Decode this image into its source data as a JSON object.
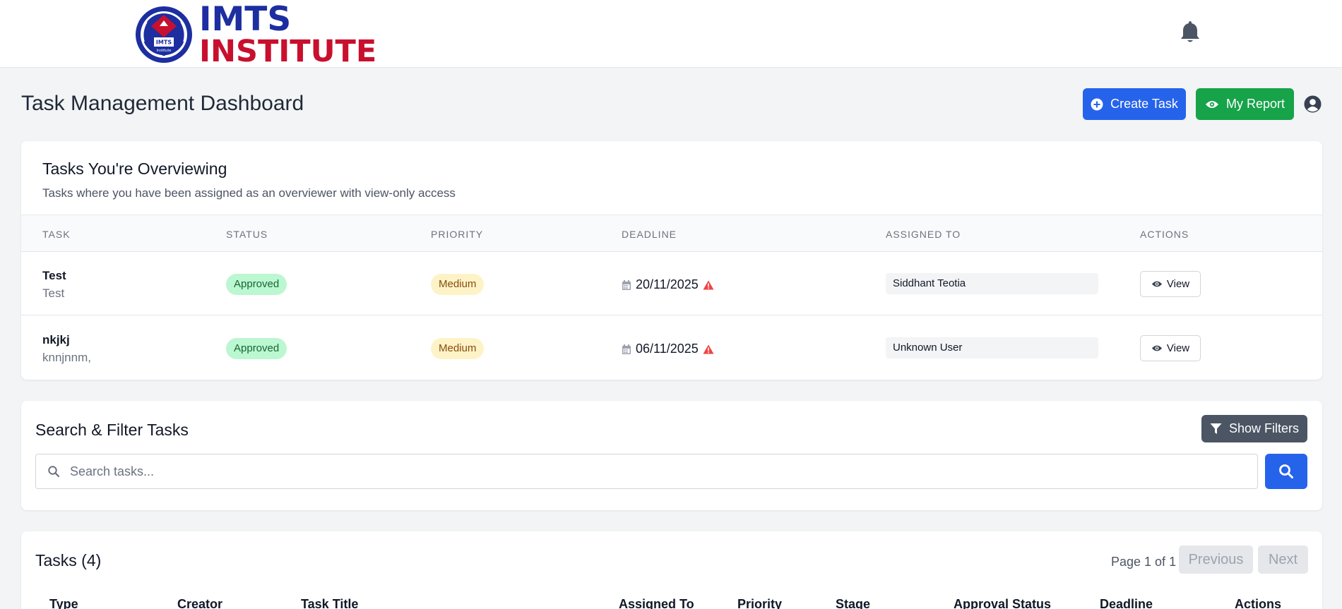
{
  "header": {
    "logo": {
      "line1": "IMTS",
      "line2": "INSTITUTE",
      "seal_text": "IMTS",
      "seal_subtext": "Institute"
    },
    "bell_icon": "bell-icon"
  },
  "page": {
    "title": "Task Management Dashboard",
    "create_task_label": "Create Task",
    "my_report_label": "My Report"
  },
  "overview": {
    "title": "Tasks You're Overviewing",
    "subtitle": "Tasks where you have been assigned as an overviewer with view-only access",
    "columns": [
      "TASK",
      "STATUS",
      "PRIORITY",
      "DEADLINE",
      "ASSIGNED TO",
      "ACTIONS"
    ],
    "rows": [
      {
        "title": "Test",
        "description": "Test",
        "status": "Approved",
        "priority": "Medium",
        "deadline": "20/11/2025",
        "assigned_to": "Siddhant Teotia",
        "action": "View"
      },
      {
        "title": "nkjkj",
        "description": "knnjnnm,",
        "status": "Approved",
        "priority": "Medium",
        "deadline": "06/11/2025",
        "assigned_to": "Unknown User",
        "action": "View"
      }
    ]
  },
  "search": {
    "title": "Search & Filter Tasks",
    "show_filters_label": "Show Filters",
    "placeholder": "Search tasks...",
    "value": ""
  },
  "tasks": {
    "title": "Tasks (4)",
    "page_info": "Page 1 of 1",
    "previous_label": "Previous",
    "next_label": "Next",
    "columns": [
      "Type",
      "Creator",
      "Task Title",
      "Assigned To",
      "Priority",
      "Stage",
      "Approval Status",
      "Deadline",
      "Actions"
    ]
  },
  "colors": {
    "primary": "#2563eb",
    "success": "#16a34a",
    "secondary": "#4b5563",
    "status_approved_bg": "#bbf7d0",
    "priority_medium_bg": "#fef3c7",
    "warning_icon": "#ef4444",
    "logo_blue": "#1c2ea0",
    "logo_red": "#c8102e"
  }
}
